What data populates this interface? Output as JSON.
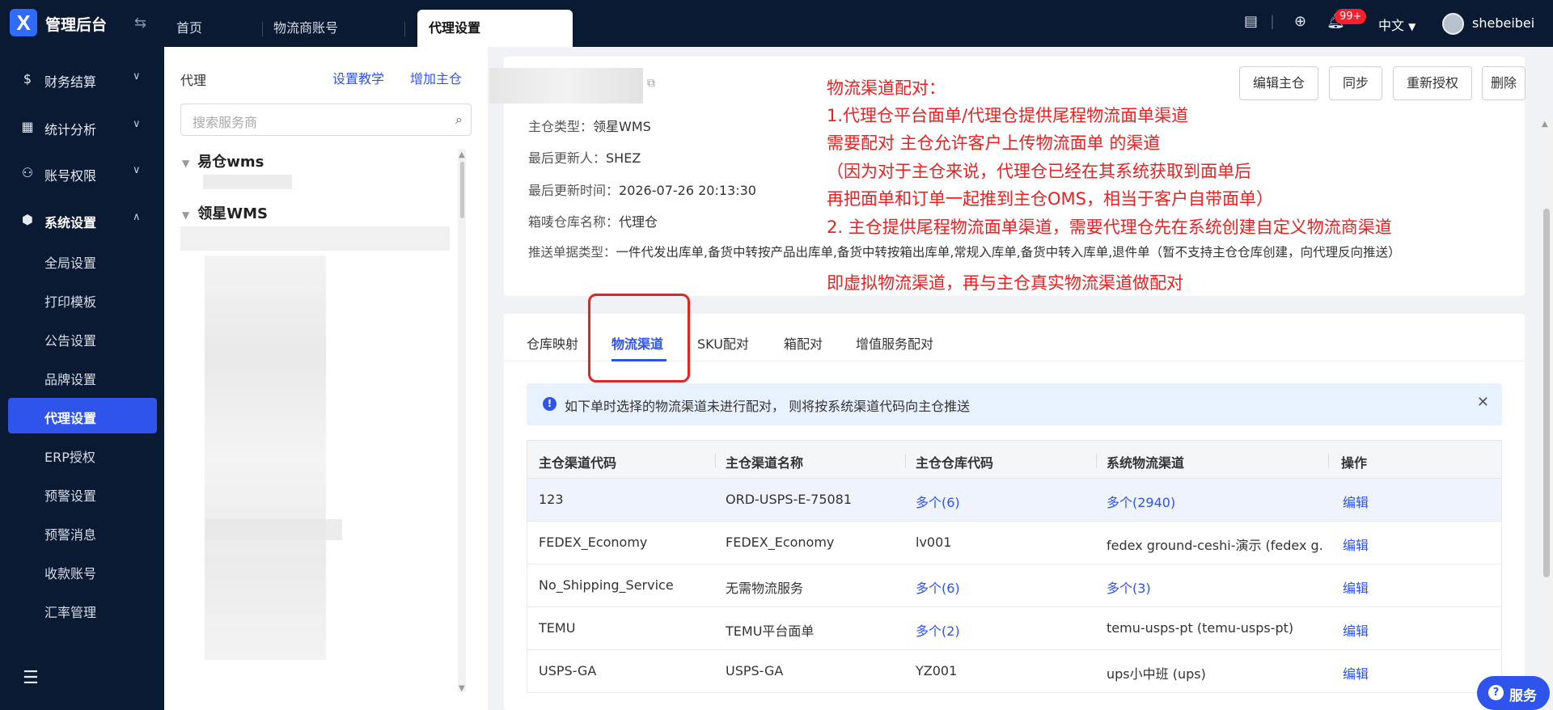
{
  "app": {
    "brand": "管理后台",
    "logo_letter": "X"
  },
  "tabs": [
    "首页",
    "物流商账号",
    "代理设置"
  ],
  "topbar": {
    "notification_count": "99+",
    "language": "中文",
    "username": "shebeibei"
  },
  "sidebar": {
    "groups": [
      {
        "label": "财务结算",
        "icon": "dollar-icon",
        "chev": "v"
      },
      {
        "label": "统计分析",
        "icon": "chart-icon",
        "chev": "v"
      },
      {
        "label": "账号权限",
        "icon": "org-icon",
        "chev": "v"
      },
      {
        "label": "系统设置",
        "icon": "gear-icon",
        "chev": "^"
      }
    ],
    "sub_items": [
      "全局设置",
      "打印模板",
      "公告设置",
      "品牌设置",
      "代理设置",
      "ERP授权",
      "预警设置",
      "预警消息",
      "收款账号",
      "汇率管理"
    ]
  },
  "middle": {
    "title": "代理",
    "link_tutorial": "设置教学",
    "link_add": "增加主仓",
    "search_placeholder": "搜索服务商",
    "nodes": [
      "易仓wms",
      "领星WMS"
    ]
  },
  "detail": {
    "lines": [
      {
        "label": "主仓类型：",
        "value": "领星WMS"
      },
      {
        "label": "最后更新人：",
        "value": "SHEZ"
      },
      {
        "label": "最后更新时间：",
        "value": "2026-07-26 20:13:30"
      },
      {
        "label": "箱唛仓库名称：",
        "value": "代理仓"
      },
      {
        "label": "推送单据类型：",
        "value": "一件代发出库单,备货中转按产品出库单,备货中转按箱出库单,常规入库单,备货中转入库单,退件单（暂不支持主仓仓库创建，向代理反向推送）"
      }
    ],
    "buttons": [
      "编辑主仓",
      "同步",
      "重新授权",
      "删除"
    ]
  },
  "annotation": [
    "物流渠道配对：",
    "1.代理仓平台面单/代理仓提供尾程物流面单渠道",
    "需要配对 主仓允许客户上传物流面单 的渠道",
    "（因为对于主仓来说，代理仓已经在其系统获取到面单后",
    "再把面单和订单一起推到主仓OMS，相当于客户自带面单）",
    "2. 主仓提供尾程物流面单渠道，需要代理仓先在系统创建自定义物流商渠道",
    "即虚拟物流渠道，再与主仓真实物流渠道做配对"
  ],
  "content_tabs": [
    "仓库映射",
    "物流渠道",
    "SKU配对",
    "箱配对",
    "增值服务配对"
  ],
  "alert": {
    "text": "如下单时选择的物流渠道未进行配对， 则将按系统渠道代码向主仓推送"
  },
  "table": {
    "headers": [
      "主仓渠道代码",
      "主仓渠道名称",
      "主仓仓库代码",
      "系统物流渠道",
      "操作"
    ],
    "rows": [
      [
        "123",
        "ORD-USPS-E-75081",
        "多个(6)",
        "多个(2940)",
        "编辑"
      ],
      [
        "FEDEX_Economy",
        "FEDEX_Economy",
        "lv001",
        "fedex ground-ceshi-演示 (fedex g...",
        "编辑"
      ],
      [
        "No_Shipping_Service",
        "无需物流服务",
        "多个(6)",
        "多个(3)",
        "编辑"
      ],
      [
        "TEMU",
        "TEMU平台面单",
        "多个(2)",
        "temu-usps-pt (temu-usps-pt)",
        "编辑"
      ],
      [
        "USPS-GA",
        "USPS-GA",
        "YZ001",
        "ups小中班 (ups)",
        "编辑"
      ]
    ]
  },
  "service_button": "服务",
  "colors": {
    "sidebar_bg": "#0b1a33",
    "primary": "#2f54eb",
    "annotation_red": "#e62222",
    "badge_red": "#f5222d"
  }
}
